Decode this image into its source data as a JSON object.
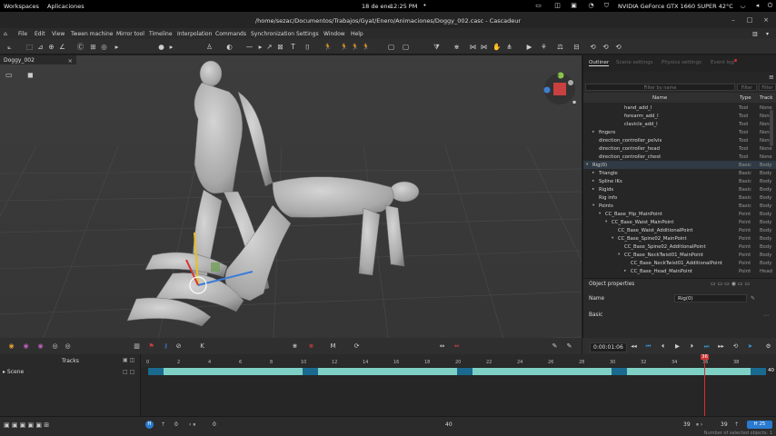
{
  "system_bar": {
    "workspaces": "Workspaces",
    "apps": "Aplicaciones",
    "date": "18 de ene",
    "time": "12:25 PM",
    "gpu": "NVIDIA GeForce GTX 1660 SUPER 42°C"
  },
  "window": {
    "title": "/home/sezac/Documentos/Trabajos/Gyat/Enero/Animaciones/Doggy_002.casc - Cascadeur"
  },
  "menu": [
    "File",
    "Edit",
    "View",
    "Tween machine",
    "Mirror tool",
    "Timeline",
    "Interpolation",
    "Commands",
    "Synchronization",
    "Settings",
    "Window",
    "Help"
  ],
  "viewport": {
    "tab_label": "Doggy_002",
    "close": "×"
  },
  "outliner": {
    "tabs": [
      "Outliner",
      "Scene settings",
      "Physics settings",
      "Event log"
    ],
    "filter_placeholder": "Filter by name",
    "filter_type": "Filter",
    "filter_track": "Filter",
    "columns": {
      "name": "Name",
      "type": "Type",
      "track": "Track"
    },
    "rows": [
      {
        "name": "hand_add_l",
        "indent": 5,
        "type": "Tool",
        "track": "None",
        "arrow": ""
      },
      {
        "name": "forearm_add_l",
        "indent": 5,
        "type": "Tool",
        "track": "None",
        "arrow": ""
      },
      {
        "name": "clavicle_add_l",
        "indent": 5,
        "type": "Tool",
        "track": "None",
        "arrow": ""
      },
      {
        "name": "fingers",
        "indent": 1,
        "type": "Tool",
        "track": "None",
        "arrow": "▸"
      },
      {
        "name": "direction_controller_pelvis",
        "indent": 1,
        "type": "Tool",
        "track": "None",
        "arrow": ""
      },
      {
        "name": "direction_controller_head",
        "indent": 1,
        "type": "Tool",
        "track": "None",
        "arrow": ""
      },
      {
        "name": "direction_controller_chest",
        "indent": 1,
        "type": "Tool",
        "track": "None",
        "arrow": ""
      },
      {
        "name": "Rig(0)",
        "indent": 0,
        "type": "Basic",
        "track": "Body",
        "arrow": "▾"
      },
      {
        "name": "Triangle",
        "indent": 1,
        "type": "Basic",
        "track": "Body",
        "arrow": "▸"
      },
      {
        "name": "Spline IKs",
        "indent": 1,
        "type": "Basic",
        "track": "Body",
        "arrow": "▸"
      },
      {
        "name": "Rigids",
        "indent": 1,
        "type": "Basic",
        "track": "Body",
        "arrow": "▸"
      },
      {
        "name": "Rig info",
        "indent": 1,
        "type": "Basic",
        "track": "Body",
        "arrow": ""
      },
      {
        "name": "Points",
        "indent": 1,
        "type": "Basic",
        "track": "Body",
        "arrow": "▾"
      },
      {
        "name": "CC_Base_Hip_MainPoint",
        "indent": 2,
        "type": "Point",
        "track": "Body",
        "arrow": "▾"
      },
      {
        "name": "CC_Base_Waist_MainPoint",
        "indent": 3,
        "type": "Point",
        "track": "Body",
        "arrow": "▾"
      },
      {
        "name": "CC_Base_Waist_AdditionalPoint",
        "indent": 4,
        "type": "Point",
        "track": "Body",
        "arrow": ""
      },
      {
        "name": "CC_Base_Spine02_MainPoint",
        "indent": 4,
        "type": "Point",
        "track": "Body",
        "arrow": "▾"
      },
      {
        "name": "CC_Base_Spine02_AdditionalPoint",
        "indent": 5,
        "type": "Point",
        "track": "Body",
        "arrow": ""
      },
      {
        "name": "CC_Base_NeckTwist01_MainPoint",
        "indent": 5,
        "type": "Point",
        "track": "Body",
        "arrow": "▾"
      },
      {
        "name": "CC_Base_NeckTwist01_AdditionalPoint",
        "indent": 6,
        "type": "Point",
        "track": "Body",
        "arrow": ""
      },
      {
        "name": "CC_Base_Head_MainPoint",
        "indent": 6,
        "type": "Point",
        "track": "Head",
        "arrow": "▸"
      }
    ]
  },
  "object_properties": {
    "header": "Object properties",
    "name_label": "Name",
    "name_value": "Rig(0)",
    "section": "Basic"
  },
  "playback": {
    "time": "0:00:01:06"
  },
  "timeline": {
    "tracks_label": "Tracks",
    "scene_label": "Scene",
    "ticks": [
      "0",
      "2",
      "4",
      "6",
      "8",
      "10",
      "12",
      "14",
      "16",
      "18",
      "20",
      "22",
      "24",
      "26",
      "28",
      "30",
      "32",
      "34",
      "36",
      "38"
    ],
    "current_frame": "36",
    "end_frame": "40",
    "segments": [
      {
        "start": 0,
        "end": 1,
        "color": "#1a6a8f"
      },
      {
        "start": 1,
        "end": 10,
        "color": "#7fd0c4"
      },
      {
        "start": 10,
        "end": 11,
        "color": "#1a6a8f"
      },
      {
        "start": 11,
        "end": 20,
        "color": "#7fd0c4"
      },
      {
        "start": 20,
        "end": 21,
        "color": "#1a6a8f"
      },
      {
        "start": 21,
        "end": 30,
        "color": "#7fd0c4"
      },
      {
        "start": 30,
        "end": 31,
        "color": "#1a6a8f"
      },
      {
        "start": 31,
        "end": 39,
        "color": "#7fd0c4"
      },
      {
        "start": 39,
        "end": 40,
        "color": "#1a6a8f"
      }
    ]
  },
  "bottom_bar": {
    "start_frame": "0",
    "range_start": "0",
    "range_mid": "40",
    "range_end": "39",
    "range_end2": "39",
    "fps": "25",
    "selection_info": "Number of selected objects: 1"
  }
}
